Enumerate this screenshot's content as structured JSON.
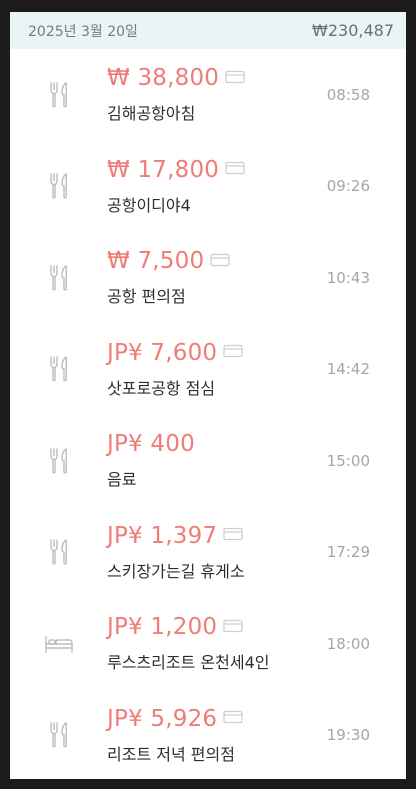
{
  "header": {
    "date": "2025년 3월 20일",
    "total": "₩230,487"
  },
  "colors": {
    "amount": "#ef7d77",
    "header_bg": "#eaf3f6",
    "time": "#a6a6a6"
  },
  "entries": [
    {
      "category_icon": "fork-knife-icon",
      "amount": "₩ 38,800",
      "card": true,
      "description": "김해공항아침",
      "time": "08:58"
    },
    {
      "category_icon": "fork-knife-icon",
      "amount": "₩ 17,800",
      "card": true,
      "description": "공항이디야4",
      "time": "09:26"
    },
    {
      "category_icon": "fork-knife-icon",
      "amount": "₩ 7,500",
      "card": true,
      "description": "공항 편의점",
      "time": "10:43"
    },
    {
      "category_icon": "fork-knife-icon",
      "amount": "JP¥ 7,600",
      "card": true,
      "description": "삿포로공항 점심",
      "time": "14:42"
    },
    {
      "category_icon": "fork-knife-icon",
      "amount": "JP¥ 400",
      "card": false,
      "description": "음료",
      "time": "15:00"
    },
    {
      "category_icon": "fork-knife-icon",
      "amount": "JP¥ 1,397",
      "card": true,
      "description": "스키장가는길 휴게소",
      "time": "17:29"
    },
    {
      "category_icon": "bed-icon",
      "amount": "JP¥ 1,200",
      "card": true,
      "description": "루스츠리조트 온천세4인",
      "time": "18:00"
    },
    {
      "category_icon": "fork-knife-icon",
      "amount": "JP¥ 5,926",
      "card": true,
      "description": "리조트 저녁 편의점",
      "time": "19:30"
    }
  ]
}
